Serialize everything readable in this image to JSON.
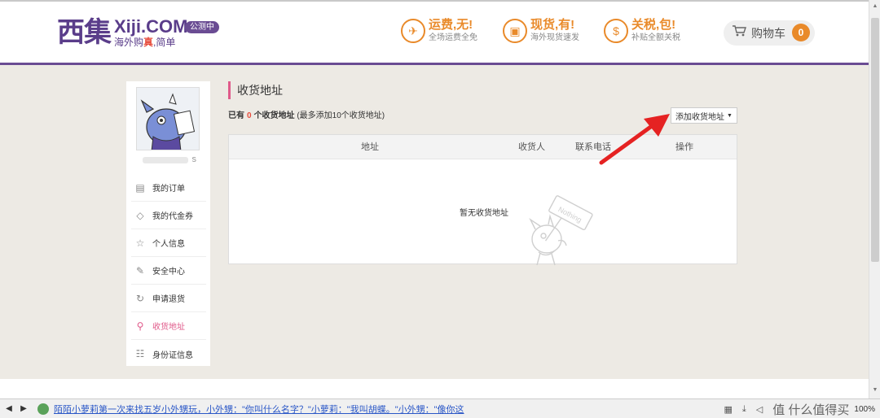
{
  "header": {
    "logo_cn": "西集",
    "logo_en": "Xiji.COM",
    "slogan_prefix": "海外购",
    "slogan_highlight": "真",
    "slogan_suffix": ",简单",
    "beta_badge": "公测中",
    "promos": [
      {
        "title": "运费,无!",
        "sub": "全场运费全免",
        "icon": "plane-icon"
      },
      {
        "title": "现货,有!",
        "sub": "海外现货速发",
        "icon": "gift-icon"
      },
      {
        "title": "关税,包!",
        "sub": "补贴全额关税",
        "icon": "money-bag-icon"
      }
    ],
    "cart": {
      "label": "购物车",
      "count": "0"
    }
  },
  "sidebar": {
    "username_suffix": "s",
    "items": [
      {
        "label": "我的订单",
        "icon": "order-icon"
      },
      {
        "label": "我的代金券",
        "icon": "coupon-icon"
      },
      {
        "label": "个人信息",
        "icon": "star-icon"
      },
      {
        "label": "安全中心",
        "icon": "edit-icon"
      },
      {
        "label": "申请退货",
        "icon": "refresh-icon"
      },
      {
        "label": "收货地址",
        "icon": "location-icon",
        "active": true
      },
      {
        "label": "身份证信息",
        "icon": "id-card-icon"
      }
    ]
  },
  "main": {
    "section_title": "收货地址",
    "summary_prefix": "已有",
    "summary_count": "0",
    "summary_mid": "个收货地址",
    "summary_note": "(最多添加10个收货地址)",
    "add_button": "添加收货地址",
    "table_headers": [
      "地址",
      "收货人",
      "联系电话",
      "操作"
    ],
    "empty_text": "暂无收货地址",
    "mascot_sign": "Nothing"
  },
  "statusbar": {
    "news_text": "陌陌小萝莉第一次来找五岁小外甥玩，小外甥：\"你叫什么名字？\"小萝莉：\"我叫胡蝶。\"小外甥：\"像你这",
    "watermark": "值 什么值得买",
    "zoom": "100%"
  },
  "colors": {
    "brand_purple": "#5a3d8a",
    "accent_orange": "#e98a2a",
    "active_pink": "#e05a8a",
    "arrow_red": "#e52222"
  }
}
